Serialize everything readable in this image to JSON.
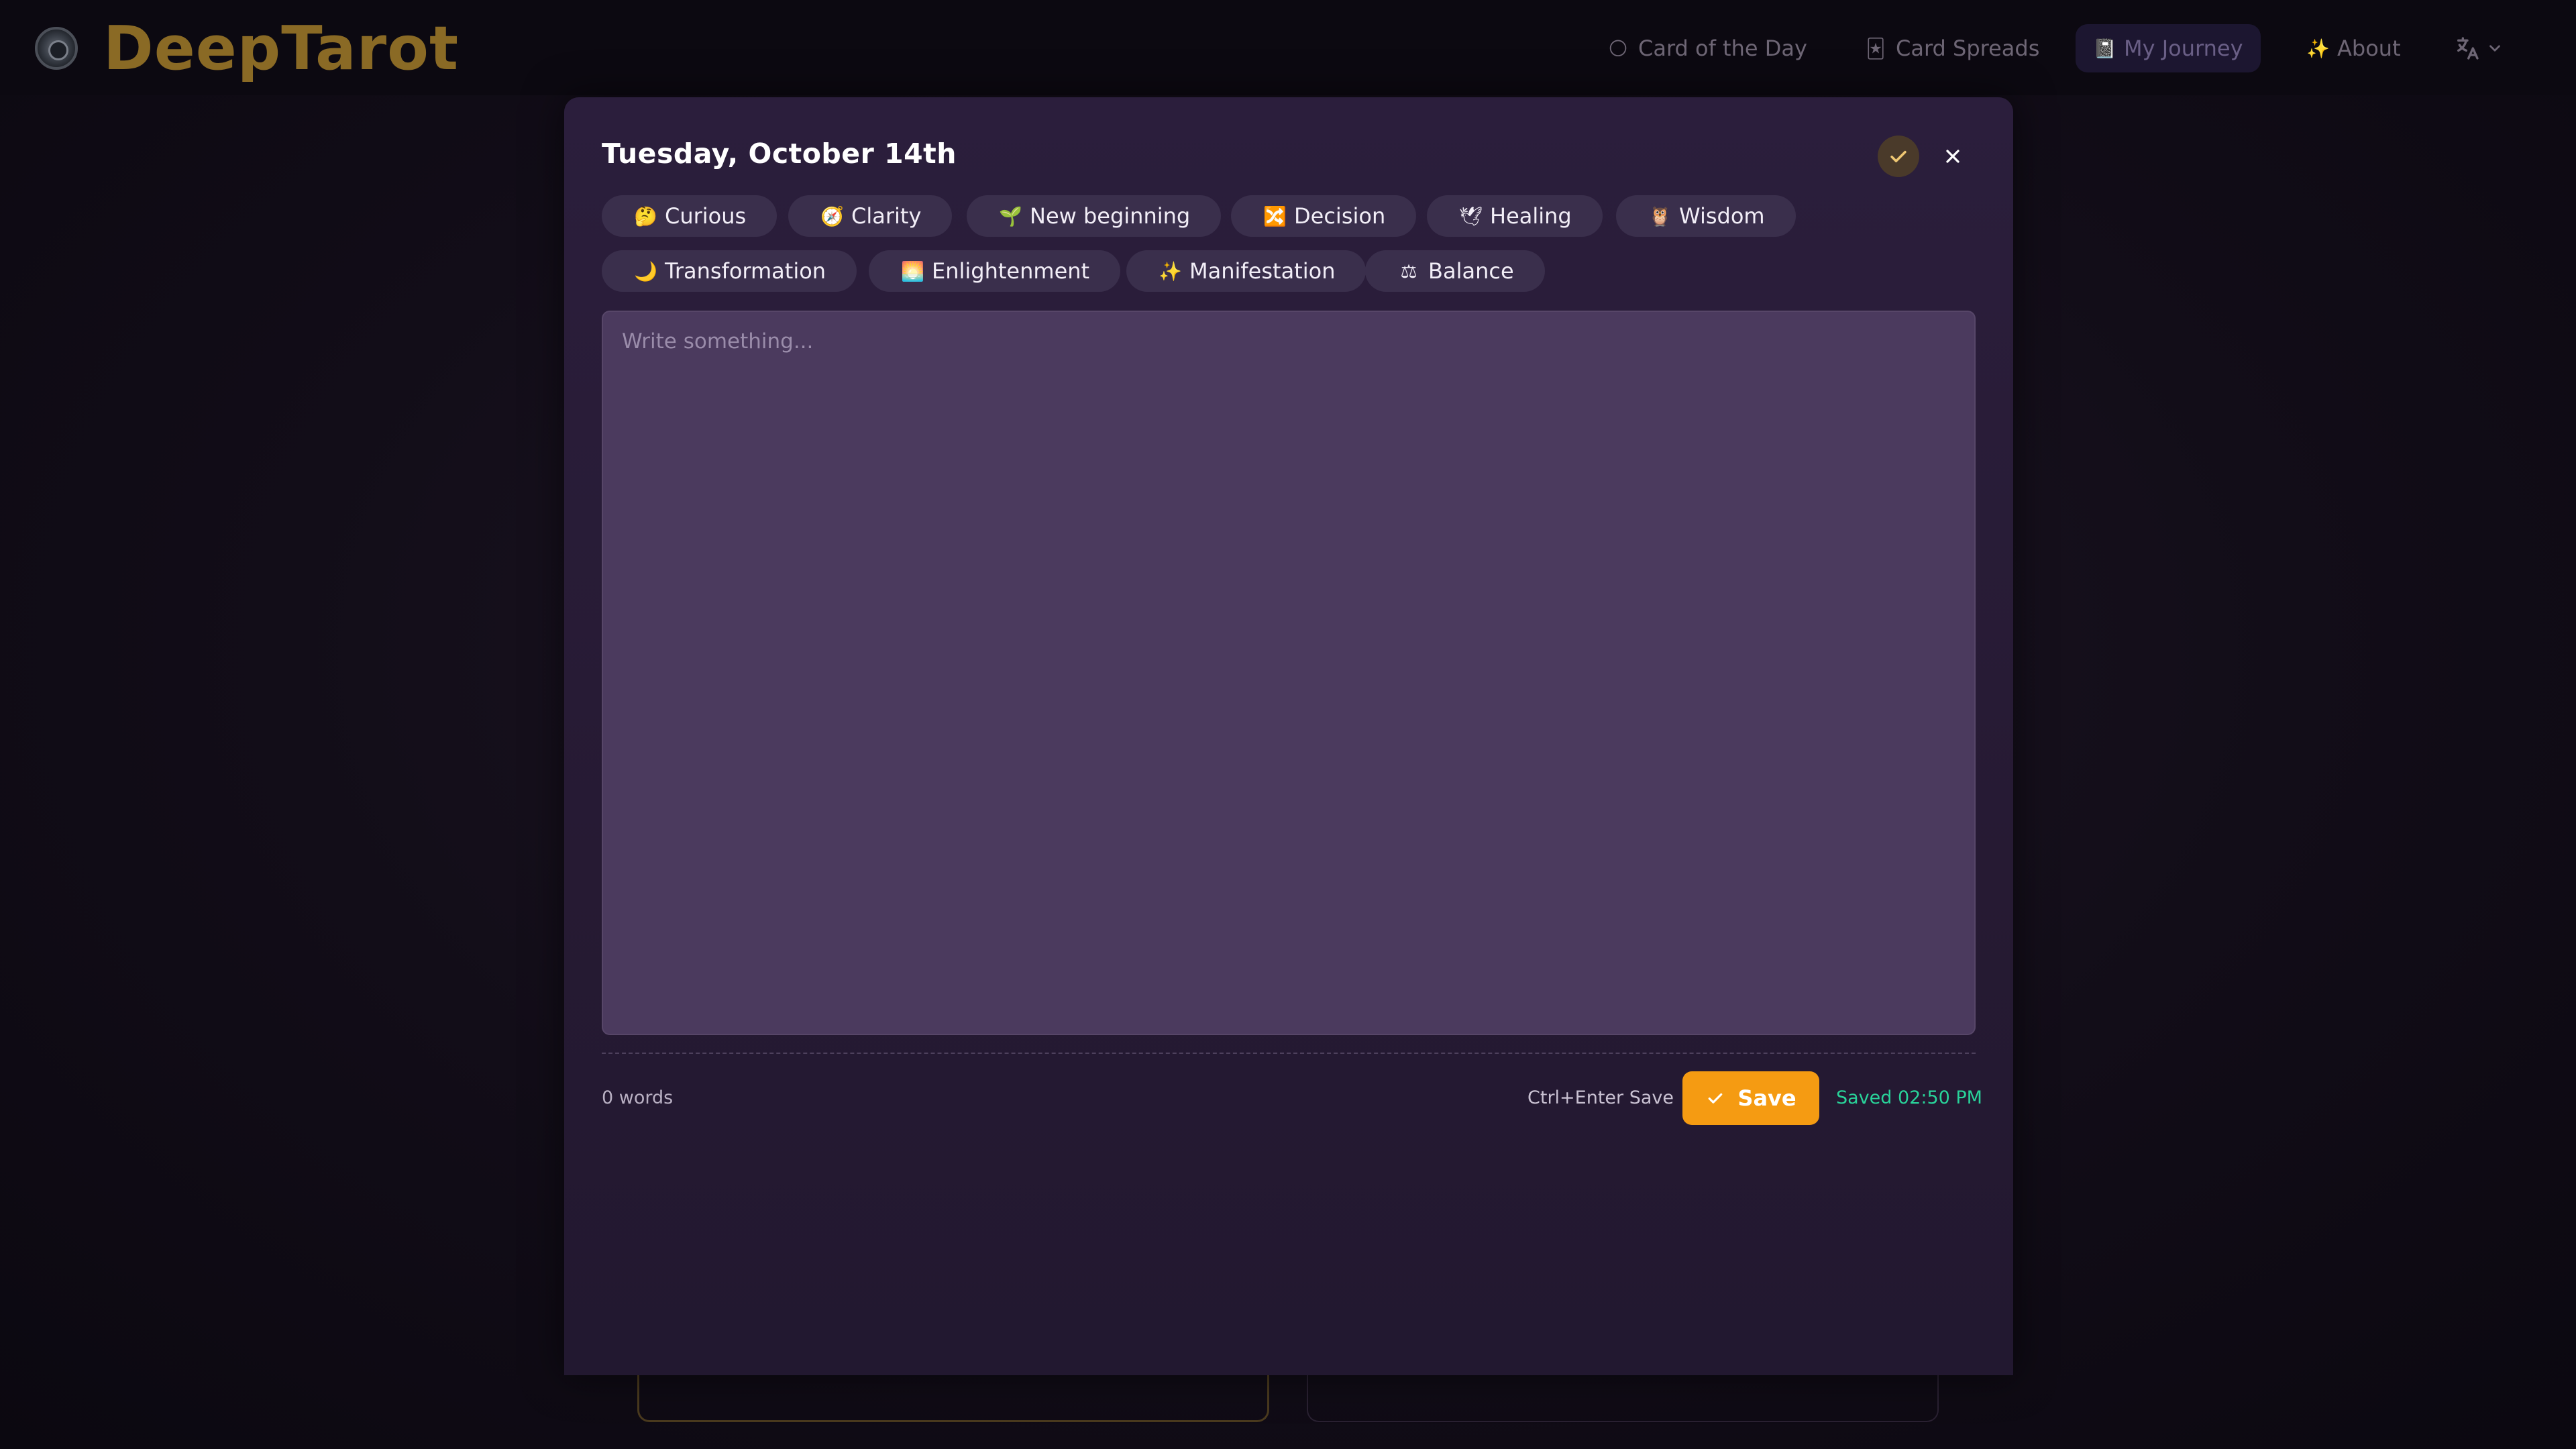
{
  "app": {
    "name": "DeepTarot"
  },
  "nav": {
    "items": [
      {
        "label": "Card of the Day",
        "icon": "🌕"
      },
      {
        "label": "Card Spreads",
        "icon": "🃏"
      },
      {
        "label": "My Journey",
        "icon": "📓",
        "active": true
      },
      {
        "label": "About",
        "icon": "✨"
      }
    ],
    "language_icon": "translate-icon"
  },
  "modal": {
    "title": "Tuesday, October 14th",
    "tags": [
      {
        "emoji": "🤔",
        "label": "Curious"
      },
      {
        "emoji": "🧭",
        "label": "Clarity"
      },
      {
        "emoji": "🌱",
        "label": "New beginning"
      },
      {
        "emoji": "🔀",
        "label": "Decision"
      },
      {
        "emoji": "🕊",
        "label": "Healing"
      },
      {
        "emoji": "🦉",
        "label": "Wisdom"
      },
      {
        "emoji": "🌙",
        "label": "Transformation"
      },
      {
        "emoji": "🌅",
        "label": "Enlightenment"
      },
      {
        "emoji": "✨",
        "label": "Manifestation"
      },
      {
        "emoji": "⚖",
        "label": "Balance"
      }
    ],
    "editor": {
      "placeholder": "Write something...",
      "value": ""
    },
    "footer": {
      "word_count": "0 words",
      "shortcut_hint": "Ctrl+Enter Save",
      "save_label": "Save",
      "saved_status": "Saved 02:50 PM"
    }
  },
  "colors": {
    "accent": "#f59b12",
    "saved": "#29d39a",
    "logo": "#8a6a25",
    "modal_bg": "#2b1e3c",
    "tag_bg": "#3a2f4c",
    "editor_bg": "#4b3a5e"
  }
}
